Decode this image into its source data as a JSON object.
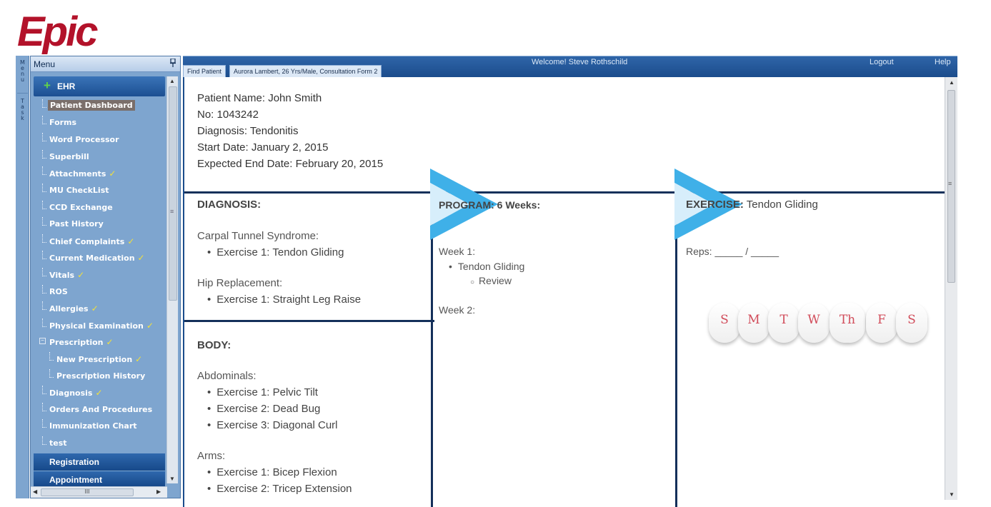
{
  "brand": {
    "logo_text": "Epic",
    "logo_color": "#b3122a"
  },
  "left_tabs": {
    "menu": "M e n u",
    "task": "T a s k"
  },
  "menu": {
    "title": "Menu",
    "pin_icon": "pin-icon",
    "root": {
      "label": "EHR",
      "icon": "plus-icon",
      "icon_color": "#61d24a"
    },
    "items": [
      {
        "label": "Patient Dashboard",
        "checked": false,
        "selected": true
      },
      {
        "label": "Forms",
        "checked": false
      },
      {
        "label": "Word Processor",
        "checked": false
      },
      {
        "label": "Superbill",
        "checked": false
      },
      {
        "label": "Attachments",
        "checked": true
      },
      {
        "label": "MU CheckList",
        "checked": false
      },
      {
        "label": "CCD Exchange",
        "checked": false
      },
      {
        "label": "Past History",
        "checked": false
      },
      {
        "label": "Chief Complaints",
        "checked": true
      },
      {
        "label": "Current Medication",
        "checked": true
      },
      {
        "label": "Vitals",
        "checked": true
      },
      {
        "label": "ROS",
        "checked": false
      },
      {
        "label": "Allergies",
        "checked": true
      },
      {
        "label": "Physical Examination",
        "checked": true
      },
      {
        "label": "Prescription",
        "checked": true,
        "expanded": true
      },
      {
        "label": "New Prescription",
        "checked": true,
        "sub": true
      },
      {
        "label": "Prescription History",
        "checked": false,
        "sub": true
      },
      {
        "label": "Diagnosis",
        "checked": true
      },
      {
        "label": "Orders And Procedures",
        "checked": false
      },
      {
        "label": "Immunization Chart",
        "checked": false
      },
      {
        "label": "test",
        "checked": false
      }
    ],
    "check_mark": "✓",
    "bottom": {
      "registration": "Registration",
      "appointment": "Appointment"
    },
    "hscroll_grip": "III"
  },
  "topbar": {
    "tabs": [
      "Find Patient",
      "Aurora Lambert, 26 Yrs/Male, Consultation Form 2"
    ],
    "welcome": "Welcome! Steve Rothschild",
    "logout": "Logout",
    "help": "Help"
  },
  "patient": {
    "name": "Patient Name: John Smith",
    "no": "No: 1043242",
    "diagnosis": "Diagnosis: Tendonitis",
    "start": "Start Date: January 2, 2015",
    "end": "Expected End Date: February 20, 2015"
  },
  "diagnosis_section": {
    "title": "DIAGNOSIS:",
    "groups": [
      {
        "name": "Carpal Tunnel Syndrome:",
        "items": [
          "Exercise 1: Tendon Gliding"
        ]
      },
      {
        "name": "Hip Replacement:",
        "items": [
          "Exercise 1: Straight Leg Raise"
        ]
      }
    ]
  },
  "body_section": {
    "title": "BODY:",
    "groups": [
      {
        "name": "Abdominals:",
        "items": [
          "Exercise 1: Pelvic Tilt",
          "Exercise 2: Dead Bug",
          "Exercise 3: Diagonal Curl"
        ]
      },
      {
        "name": "Arms:",
        "items": [
          "Exercise 1: Bicep Flexion",
          "Exercise 2: Tricep Extension"
        ]
      }
    ]
  },
  "program_section": {
    "title": "PROGRAM: 6 Weeks:",
    "week1": "Week 1:",
    "week1_item": "Tendon Gliding",
    "week1_sub": "Review",
    "week2": "Week 2:"
  },
  "exercise_section": {
    "title_bold": "EXERCISE:",
    "title_rest": " Tendon Gliding",
    "reps": "Reps: _____ / _____",
    "days": [
      "S",
      "M",
      "T",
      "W",
      "Th",
      "F",
      "S"
    ]
  },
  "colors": {
    "accent_dark": "#14305a",
    "chevron": "#3fb0e8",
    "day_letter": "#d14c5a",
    "check": "#f3e03a"
  }
}
